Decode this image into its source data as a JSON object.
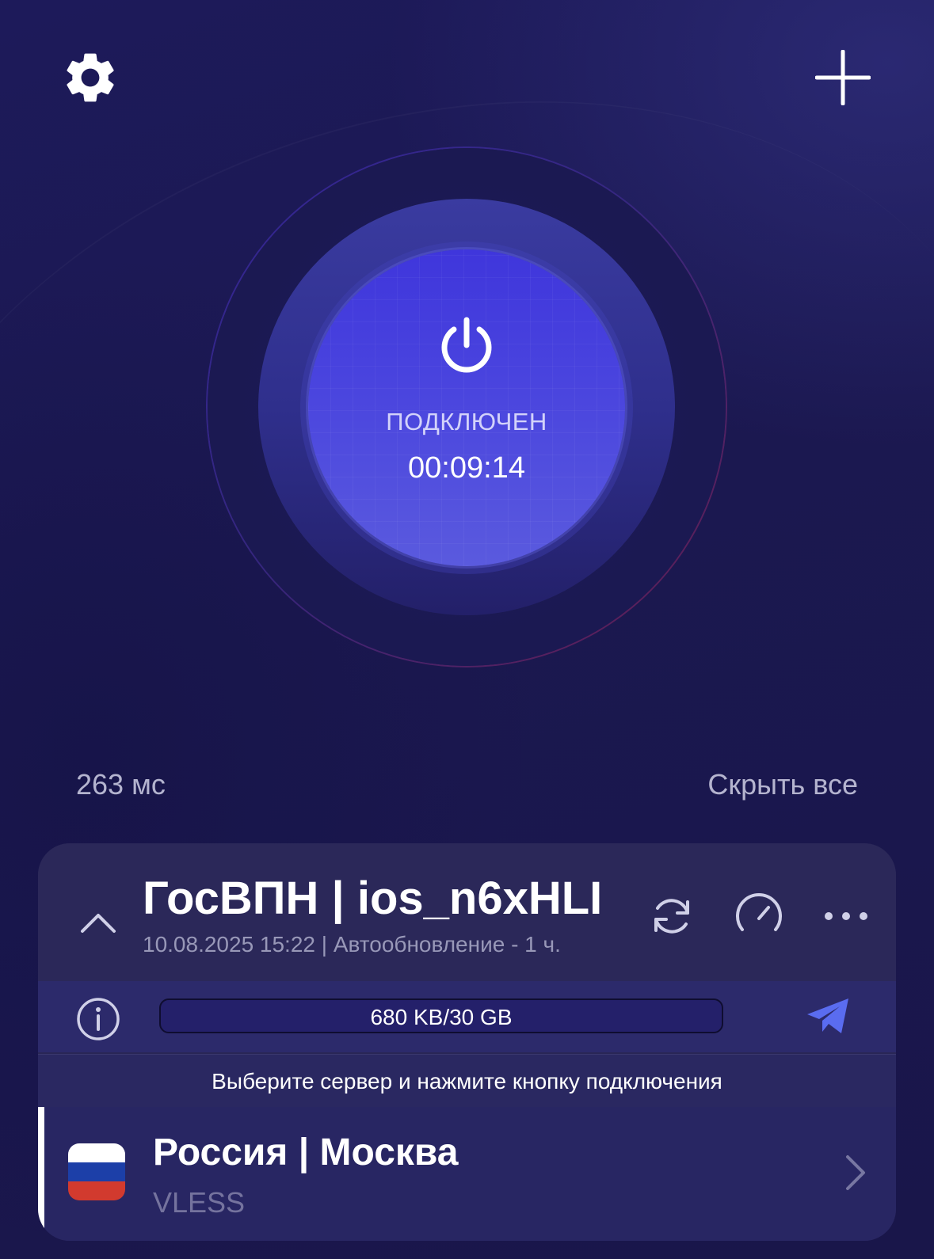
{
  "topbar": {
    "settings_icon": "gear-icon",
    "add_icon": "plus-icon"
  },
  "connection": {
    "status": "ПОДКЛЮЧЕН",
    "timer": "00:09:14",
    "power_icon": "power-icon"
  },
  "stats": {
    "ping": "263 мс",
    "hide_all": "Скрыть все"
  },
  "subscription": {
    "name": "ГосВПН | ios_n6xHLI",
    "meta": "10.08.2025 15:22 | Автообновление - 1 ч.",
    "traffic_label": "680 KB/30 GB",
    "traffic_fraction": 0.0,
    "hint": "Выберите сервер и нажмите кнопку подключения",
    "icons": [
      "chevron-up-icon",
      "refresh-icon",
      "speedometer-icon",
      "more-dots-icon",
      "info-icon",
      "telegram-icon"
    ]
  },
  "server": {
    "name": "Россия | Москва",
    "protocol": "VLESS",
    "flag_colors": [
      "#ffffff",
      "#1c3fa8",
      "#d23a2e"
    ]
  },
  "colors": {
    "background": "#1b1850",
    "button": "#4a45de",
    "card": "#292656",
    "telegram": "#5a6cf0"
  }
}
